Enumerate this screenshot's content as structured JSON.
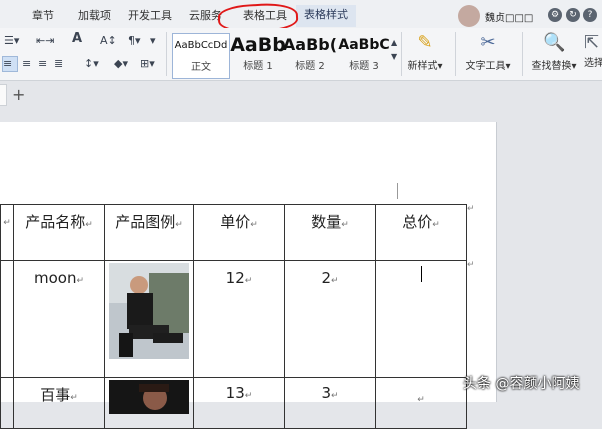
{
  "menu": {
    "tabs": [
      {
        "label": "章节"
      },
      {
        "label": "加载项"
      },
      {
        "label": "开发工具"
      },
      {
        "label": "云服务"
      },
      {
        "label": "表格工具"
      },
      {
        "label": "表格样式"
      }
    ],
    "user_name": "魏贞□□□"
  },
  "ribbon": {
    "styles": [
      {
        "sample": "AaBbCcDd",
        "label": "正文"
      },
      {
        "sample": "AaBb",
        "label": "标题 1"
      },
      {
        "sample": "AaBb(",
        "label": "标题 2"
      },
      {
        "sample": "AaBbC",
        "label": "标题 3"
      }
    ],
    "new_style": "新样式",
    "text_tools": "文字工具",
    "find_replace": "查找替换",
    "select": "选择",
    "font_size_btn": "A"
  },
  "doc_tabs": {
    "add_label": "+"
  },
  "table": {
    "headers": [
      "产品名称",
      "产品图例",
      "单价",
      "数量",
      "总价"
    ],
    "rows": [
      {
        "name": "moon",
        "price": "12",
        "qty": "2",
        "total": ""
      },
      {
        "name": "百事",
        "price": "13",
        "qty": "3",
        "total": ""
      }
    ],
    "cell_mark": "↵"
  },
  "watermark": "头条 @容颜小阿姨",
  "colors": {
    "annotation_circle": "#e01818",
    "active_tab_bg": "#dde5f0"
  }
}
